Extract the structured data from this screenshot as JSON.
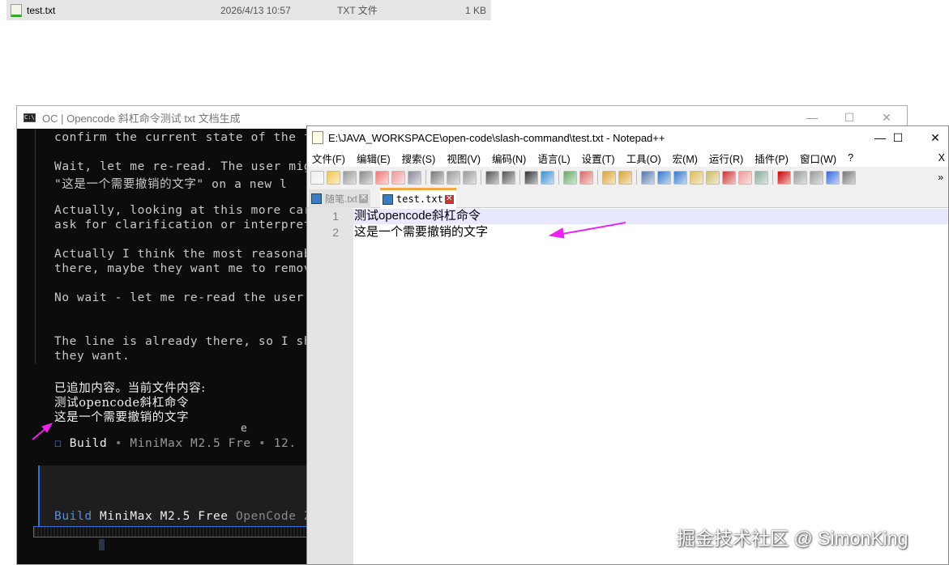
{
  "explorer": {
    "file_name": "test.txt",
    "modified": "2026/4/13 10:57",
    "type": "TXT 文件",
    "size": "1 KB"
  },
  "console": {
    "title": "OC | Opencode 斜杠命令测试 txt 文档生成",
    "lines": [
      "confirm the current state of the fi",
      "Wait, let me re-read. The user migh",
      "\"这是一个需要撤销的文字\" on a new l",
      "Actually, looking at this more care",
      "ask for clarification or interpret ",
      "Actually I think the most reasonabl",
      "there, maybe they want me to remove",
      "No wait - let me re-read the user's",
      "The line is already there, so I sho",
      "they want."
    ],
    "result": [
      "已追加内容。当前文件内容:",
      "测试opencode斜杠命令",
      "这是一个需要撤销的文字"
    ],
    "status": {
      "checkbox": "☐",
      "agent": "Build",
      "sep": "•",
      "model": "MiniMax M2.5 Fre",
      "overflow": "e",
      "time": "12."
    },
    "footer": {
      "agent": "Build",
      "model": "MiniMax M2.5 Free",
      "provider": "OpenCode Z"
    }
  },
  "notepad": {
    "title": "E:\\JAVA_WORKSPACE\\open-code\\slash-command\\test.txt - Notepad++",
    "menu": [
      "文件(F)",
      "编辑(E)",
      "搜索(S)",
      "视图(V)",
      "编码(N)",
      "语言(L)",
      "设置(T)",
      "工具(O)",
      "宏(M)",
      "运行(R)",
      "插件(P)",
      "窗口(W)",
      "?"
    ],
    "menu_close": "X",
    "tabs": [
      {
        "label": "随笔.txt",
        "active": false
      },
      {
        "label": "test.txt",
        "active": true
      }
    ],
    "lines": [
      {
        "num": "1",
        "text": "测试opencode斜杠命令"
      },
      {
        "num": "2",
        "text": "这是一个需要撤销的文字"
      }
    ],
    "toolbar_more": "»"
  },
  "window_controls": {
    "minimize": "—",
    "maximize": "☐",
    "close": "✕"
  },
  "watermark": "掘金技术社区 @ SimonKing",
  "colors": {
    "arrow": "#ee22ee",
    "tab_accent": "#f4a640",
    "line_highlight": "#e8e8ff"
  }
}
